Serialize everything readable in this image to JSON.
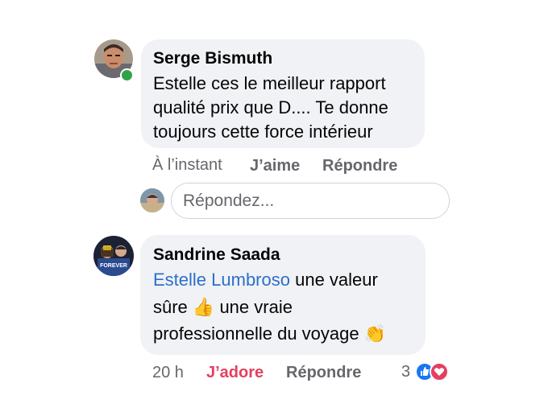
{
  "comments": [
    {
      "author": "Serge Bismuth",
      "text_lines": [
        "Estelle ces le meilleur rapport",
        "qualité prix que D.... Te donne",
        "toujours cette force intérieur"
      ],
      "timestamp": "À l’instant",
      "like_label": "J’aime",
      "reply_label": "Répondre",
      "online": true
    },
    {
      "author": "Sandrine Saada",
      "mention": "Estelle Lumbroso",
      "text_line1_rest": " une valeur",
      "text_line2_a": "sûre ",
      "text_line2_b": " une vraie",
      "text_line3": "professionnelle du voyage ",
      "emoji_thumbs": "👍",
      "emoji_clap": "👏",
      "timestamp": "20 h",
      "like_label": "J’adore",
      "reply_label": "Répondre",
      "reaction_count": "3",
      "reactions": [
        "like-icon",
        "love-icon"
      ],
      "avatar_caption": "FOREVER"
    }
  ],
  "reply_input": {
    "placeholder": "Répondez..."
  },
  "colors": {
    "mention": "#2d6fc9",
    "love": "#e4405f",
    "like": "#1877f2",
    "online": "#31a24c"
  }
}
